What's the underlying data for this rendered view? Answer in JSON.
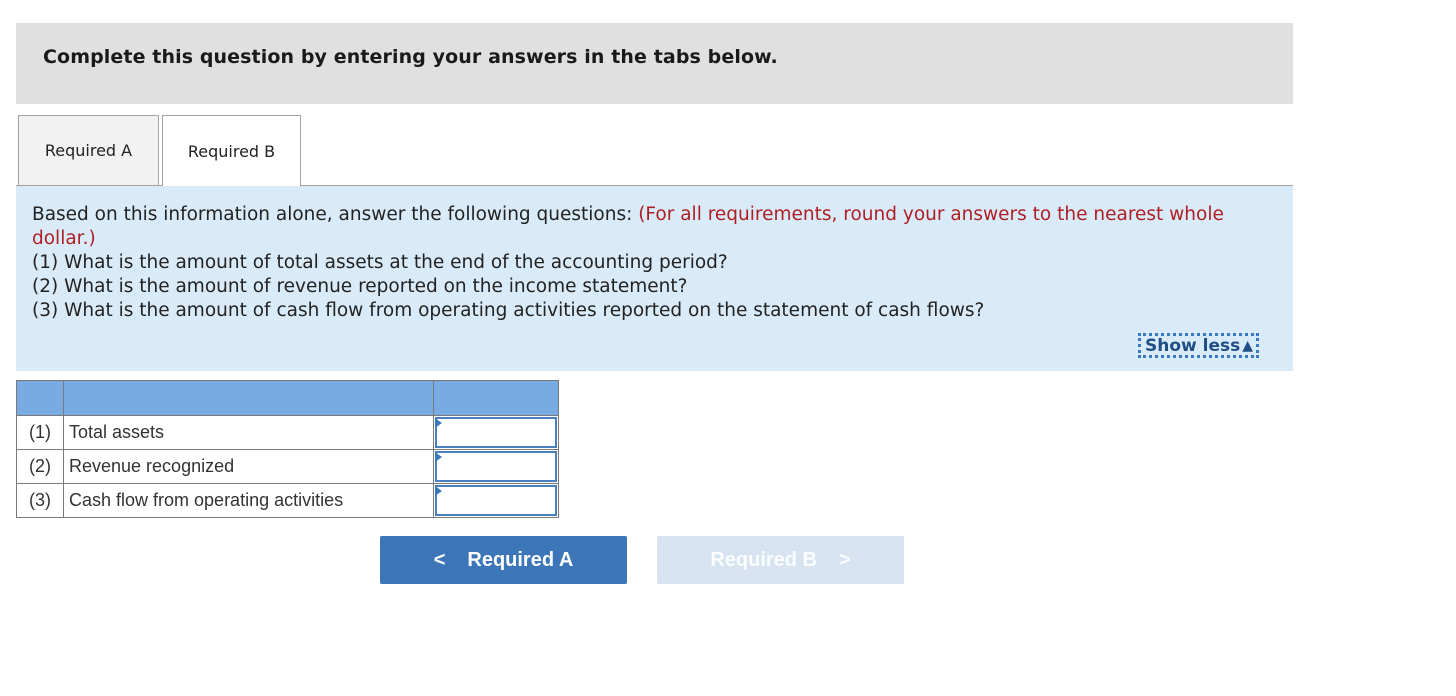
{
  "instructions": {
    "title": "Complete this question by entering your answers in the tabs below."
  },
  "tabs": [
    {
      "label": "Required A",
      "active": false
    },
    {
      "label": "Required B",
      "active": true
    }
  ],
  "question": {
    "intro": "Based on this information alone, answer the following questions: ",
    "note": "(For all requirements, round your answers to the nearest whole dollar.)",
    "items": [
      "(1) What is the amount of total assets at the end of the accounting period?",
      "(2) What is the amount of revenue reported on the income statement?",
      "(3) What is the amount of cash flow from operating activities reported on the statement of cash flows?"
    ],
    "toggle_label": "Show less",
    "toggle_icon": "triangle-up-icon"
  },
  "table": {
    "headers": [
      "",
      "",
      ""
    ],
    "rows": [
      {
        "number": "(1)",
        "label": "Total assets",
        "value": ""
      },
      {
        "number": "(2)",
        "label": "Revenue recognized",
        "value": ""
      },
      {
        "number": "(3)",
        "label": "Cash flow from operating activities",
        "value": ""
      }
    ]
  },
  "navigation": {
    "prev_label": "Required A",
    "prev_icon": "chevron-left-icon",
    "next_label": "Required B",
    "next_icon": "chevron-right-icon",
    "next_disabled": true
  },
  "colors": {
    "banner_bg": "#e0e0e0",
    "panel_bg": "#d9ebf8",
    "note_red": "#b01e23",
    "table_header": "#78abe2",
    "accent_blue": "#3c76b9",
    "disabled_btn": "#d7e3f1"
  }
}
